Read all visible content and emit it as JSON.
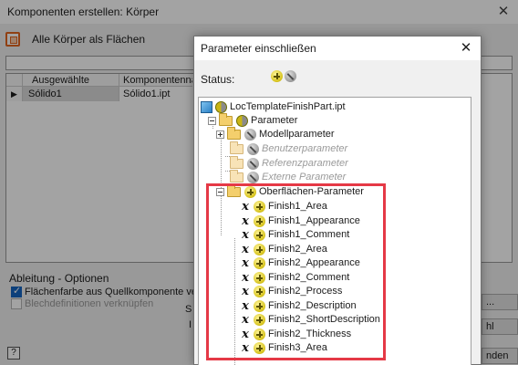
{
  "background_dialog": {
    "title": "Komponenten erstellen: Körper",
    "close_glyph": "✕",
    "toolbar_label": "Alle Körper als Flächen",
    "grid": {
      "col_selected": "Ausgewählte Körper",
      "col_component": "Komponentenna",
      "row_marker": "▶",
      "rows": [
        {
          "body": "Sólido1",
          "component": "Sólido1.ipt"
        }
      ]
    },
    "options_title": "Ableitung - Optionen",
    "option_surface_color": "Flächenfarbe aus Quellkomponente verknü",
    "option_sheet_metal": "Blechdefinitionen verknüpfen",
    "side_letters": [
      "S",
      "I"
    ],
    "help_glyph": "?",
    "right_buttons": [
      "...",
      "hl",
      "nden"
    ]
  },
  "dialog": {
    "title": "Parameter einschließen",
    "close_glyph": "✕",
    "status_label": "Status:",
    "status_icons": [
      "plus-circle-icon",
      "no-entry-icon"
    ]
  },
  "tree": {
    "root": "LocTemplateFinishPart.ipt",
    "parameter": "Parameter",
    "model": "Modellparameter",
    "user": "Benutzerparameter",
    "reference": "Referenzparameter",
    "external": "Externe Parameter",
    "surface": "Oberflächen-Parameter",
    "items": [
      "Finish1_Area",
      "Finish1_Appearance",
      "Finish1_Comment",
      "Finish2_Area",
      "Finish2_Appearance",
      "Finish2_Comment",
      "Finish2_Process",
      "Finish2_Description",
      "Finish2_ShortDescription",
      "Finish2_Thickness",
      "Finish3_Area"
    ]
  },
  "colors": {
    "highlight": "#e53946",
    "checkbox_checked": "#1565c0"
  }
}
